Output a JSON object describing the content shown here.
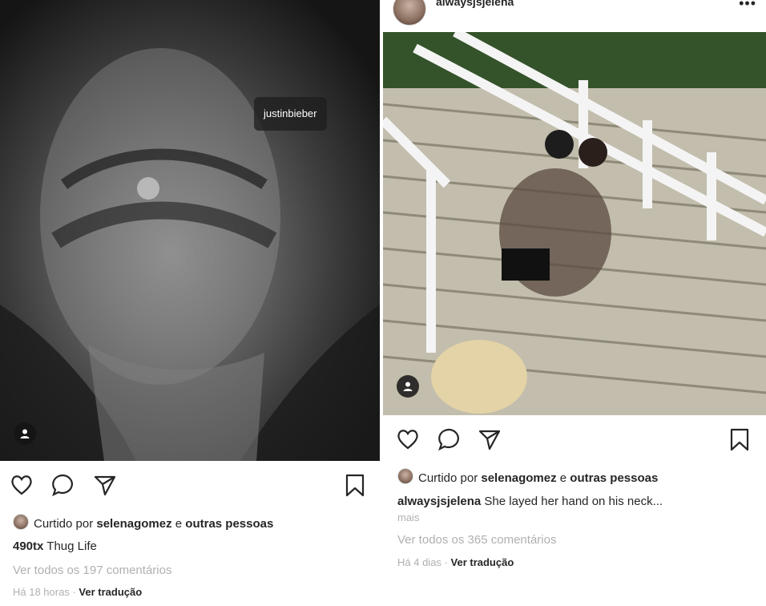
{
  "left_post": {
    "photo_tag": "justinbieber",
    "liked_prefix": "Curtido por",
    "liked_user": "selenagomez",
    "liked_join": "e",
    "liked_others": "outras pessoas",
    "caption_user": "490tx",
    "caption_text": "Thug Life",
    "view_comments": "Ver todos os 197 comentários",
    "time": "Há 18 horas",
    "dot": "·",
    "translate": "Ver tradução"
  },
  "right_post": {
    "username": "alwaysjsjelena",
    "more": "•••",
    "liked_prefix": "Curtido por",
    "liked_user": "selenagomez",
    "liked_join": "e",
    "liked_others": "outras pessoas",
    "caption_user": "alwaysjsjelena",
    "caption_text": "She layed her hand on his neck...",
    "more_link": "mais",
    "view_comments": "Ver todos os 365 comentários",
    "time": "Há 4 dias",
    "dot": "·",
    "translate": "Ver tradução"
  },
  "icons": {
    "like": "heart-icon",
    "comment": "comment-icon",
    "share": "send-icon",
    "save": "bookmark-icon",
    "tagged": "user-icon"
  }
}
